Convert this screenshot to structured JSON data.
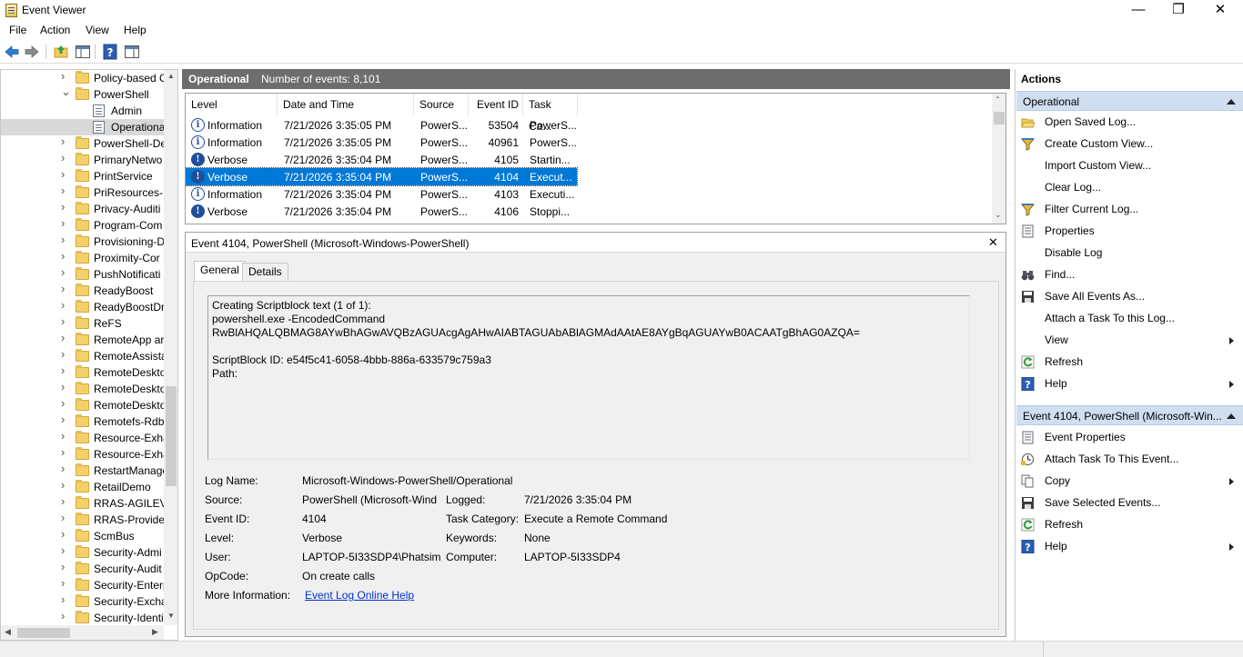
{
  "window": {
    "title": "Event Viewer",
    "minimize": "—",
    "maximize": "❐",
    "close": "✕"
  },
  "menu": [
    "File",
    "Action",
    "View",
    "Help"
  ],
  "tree": {
    "items": [
      {
        "label": "Policy-based C",
        "type": "folder",
        "expanded": false
      },
      {
        "label": "PowerShell",
        "type": "folder",
        "expanded": true
      },
      {
        "label": "Admin",
        "type": "log"
      },
      {
        "label": "Operational",
        "type": "log",
        "selected": true
      },
      {
        "label": "PowerShell-De",
        "type": "folder"
      },
      {
        "label": "PrimaryNetwo",
        "type": "folder"
      },
      {
        "label": "PrintService",
        "type": "folder"
      },
      {
        "label": "PriResources-D",
        "type": "folder"
      },
      {
        "label": "Privacy-Auditi",
        "type": "folder"
      },
      {
        "label": "Program-Com",
        "type": "folder"
      },
      {
        "label": "Provisioning-D",
        "type": "folder"
      },
      {
        "label": "Proximity-Cor",
        "type": "folder"
      },
      {
        "label": "PushNotificati",
        "type": "folder"
      },
      {
        "label": "ReadyBoost",
        "type": "folder"
      },
      {
        "label": "ReadyBoostDri",
        "type": "folder"
      },
      {
        "label": "ReFS",
        "type": "folder"
      },
      {
        "label": "RemoteApp ar",
        "type": "folder"
      },
      {
        "label": "RemoteAssista",
        "type": "folder"
      },
      {
        "label": "RemoteDeskto",
        "type": "folder"
      },
      {
        "label": "RemoteDeskto",
        "type": "folder"
      },
      {
        "label": "RemoteDeskto",
        "type": "folder"
      },
      {
        "label": "Remotefs-Rdb",
        "type": "folder"
      },
      {
        "label": "Resource-Exha",
        "type": "folder"
      },
      {
        "label": "Resource-Exha",
        "type": "folder"
      },
      {
        "label": "RestartManage",
        "type": "folder"
      },
      {
        "label": "RetailDemo",
        "type": "folder"
      },
      {
        "label": "RRAS-AGILEVP",
        "type": "folder"
      },
      {
        "label": "RRAS-Provider",
        "type": "folder"
      },
      {
        "label": "ScmBus",
        "type": "folder"
      },
      {
        "label": "Security-Admi",
        "type": "folder"
      },
      {
        "label": "Security-Audit",
        "type": "folder"
      },
      {
        "label": "Security-Enterp",
        "type": "folder"
      },
      {
        "label": "Security-Excha",
        "type": "folder"
      },
      {
        "label": "Security-Identi",
        "type": "folder"
      }
    ]
  },
  "center": {
    "log_name": "Operational",
    "event_count": "Number of events: 8,101",
    "columns": [
      "Level",
      "Date and Time",
      "Source",
      "Event ID",
      "Task Ca..."
    ],
    "rows": [
      {
        "level": "Information",
        "icon": "i",
        "date": "7/21/2026 3:35:05 PM",
        "source": "PowerS...",
        "id": "53504",
        "task": "PowerS..."
      },
      {
        "level": "Information",
        "icon": "i",
        "date": "7/21/2026 3:35:05 PM",
        "source": "PowerS...",
        "id": "40961",
        "task": "PowerS..."
      },
      {
        "level": "Verbose",
        "icon": "!",
        "date": "7/21/2026 3:35:04 PM",
        "source": "PowerS...",
        "id": "4105",
        "task": "Startin..."
      },
      {
        "level": "Verbose",
        "icon": "!",
        "date": "7/21/2026 3:35:04 PM",
        "source": "PowerS...",
        "id": "4104",
        "task": "Execut...",
        "selected": true
      },
      {
        "level": "Information",
        "icon": "i",
        "date": "7/21/2026 3:35:04 PM",
        "source": "PowerS...",
        "id": "4103",
        "task": "Executi..."
      },
      {
        "level": "Verbose",
        "icon": "!",
        "date": "7/21/2026 3:35:04 PM",
        "source": "PowerS...",
        "id": "4106",
        "task": "Stoppi..."
      }
    ]
  },
  "detail": {
    "header": "Event 4104, PowerShell (Microsoft-Windows-PowerShell)",
    "close": "✕",
    "tabs": [
      "General",
      "Details"
    ],
    "description": [
      "Creating Scriptblock text (1 of 1):",
      "powershell.exe -EncodedCommand",
      "RwBlAHQALQBMAG8AYwBhAGwAVQBzAGUAcgAgAHwAIABTAGUAbABlAGMAdAAtAE8AYgBqAGUAYwB0ACAATgBhAG0AZQA=",
      "",
      "ScriptBlock ID: e54f5c41-6058-4bbb-886a-633579c759a3",
      "Path:"
    ],
    "fields": {
      "log_name_label": "Log Name:",
      "log_name": "Microsoft-Windows-PowerShell/Operational",
      "source_label": "Source:",
      "source": "PowerShell (Microsoft-Wind",
      "logged_label": "Logged:",
      "logged": "7/21/2026 3:35:04 PM",
      "event_id_label": "Event ID:",
      "event_id": "4104",
      "task_category_label": "Task Category:",
      "task_category": "Execute a Remote Command",
      "level_label": "Level:",
      "level": "Verbose",
      "keywords_label": "Keywords:",
      "keywords": "None",
      "user_label": "User:",
      "user": "LAPTOP-5I33SDP4\\Phatsimo",
      "computer_label": "Computer:",
      "computer": "LAPTOP-5I33SDP4",
      "opcode_label": "OpCode:",
      "opcode": "On create calls",
      "more_info_label": "More Information:",
      "more_info_link": "Event Log Online Help"
    }
  },
  "actions": {
    "header": "Actions",
    "section1": "Operational",
    "items1": [
      {
        "label": "Open Saved Log...",
        "icon": "open-folder-icon"
      },
      {
        "label": "Create Custom View...",
        "icon": "funnel-icon"
      },
      {
        "label": "Import Custom View...",
        "icon": ""
      },
      {
        "label": "Clear Log...",
        "icon": ""
      },
      {
        "label": "Filter Current Log...",
        "icon": "funnel-icon"
      },
      {
        "label": "Properties",
        "icon": "properties-icon"
      },
      {
        "label": "Disable Log",
        "icon": ""
      },
      {
        "label": "Find...",
        "icon": "binoculars-icon"
      },
      {
        "label": "Save All Events As...",
        "icon": "save-icon"
      },
      {
        "label": "Attach a Task To this Log...",
        "icon": ""
      },
      {
        "label": "View",
        "icon": "",
        "submenu": true
      },
      {
        "label": "Refresh",
        "icon": "refresh-icon"
      },
      {
        "label": "Help",
        "icon": "help-icon",
        "submenu": true
      }
    ],
    "section2": "Event 4104, PowerShell (Microsoft-Win...",
    "items2": [
      {
        "label": "Event Properties",
        "icon": "properties-icon"
      },
      {
        "label": "Attach Task To This Event...",
        "icon": "task-icon"
      },
      {
        "label": "Copy",
        "icon": "copy-icon",
        "submenu": true
      },
      {
        "label": "Save Selected Events...",
        "icon": "save-icon"
      },
      {
        "label": "Refresh",
        "icon": "refresh-icon"
      },
      {
        "label": "Help",
        "icon": "help-icon",
        "submenu": true
      }
    ]
  },
  "colors": {
    "selection": "#0078d7",
    "section_header": "#cfdff0",
    "center_header": "#6d6d6d",
    "link": "#0033cc"
  }
}
